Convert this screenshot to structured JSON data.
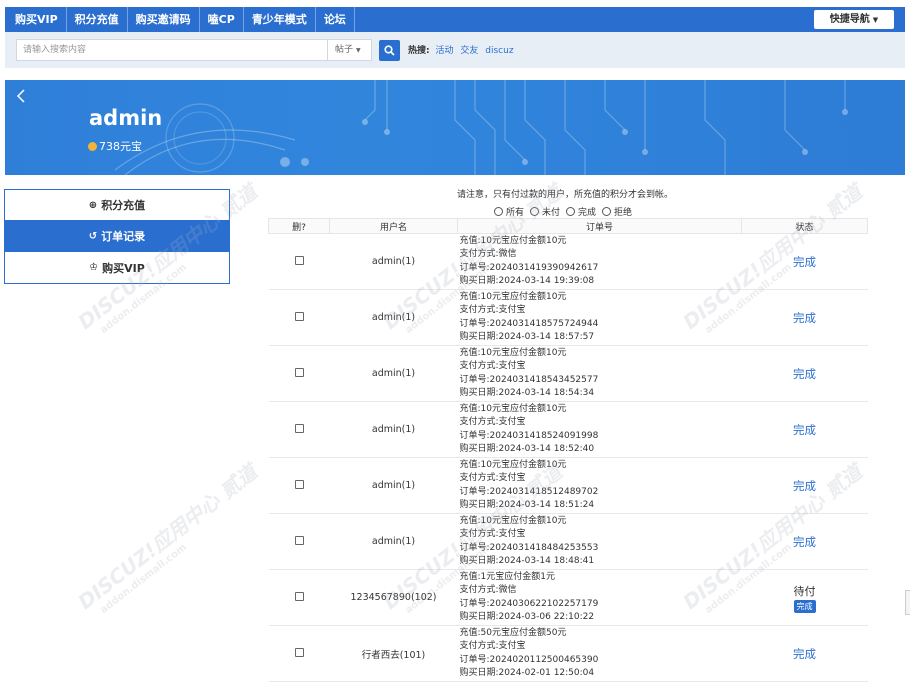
{
  "topnav": {
    "items": [
      "购买VIP",
      "积分充值",
      "购买邀请码",
      "嗑CP",
      "青少年模式",
      "论坛"
    ],
    "quick_nav": "快捷导航"
  },
  "search": {
    "placeholder": "请输入搜索内容",
    "scope": "帖子",
    "hot_label": "热搜:",
    "hot_links": [
      "活动",
      "交友",
      "discuz"
    ]
  },
  "banner": {
    "username": "admin",
    "balance": "738元宝"
  },
  "sidebar": {
    "items": [
      {
        "label": "积分充值",
        "icon": "coin-icon",
        "active": false
      },
      {
        "label": "订单记录",
        "icon": "history-icon",
        "active": true
      },
      {
        "label": "购买VIP",
        "icon": "crown-icon",
        "active": false
      }
    ]
  },
  "notice": "请注意，只有付过款的用户，所充值的积分才会到帐。",
  "filters": [
    "所有",
    "未付",
    "完成",
    "拒绝"
  ],
  "table": {
    "headers": [
      "删?",
      "用户名",
      "订单号",
      "状态"
    ],
    "rows": [
      {
        "user": "admin(1)",
        "line1": "充值:10元宝应付金额10元",
        "line2": "支付方式:微信",
        "line3": "订单号:2024031419390942617",
        "line4": "购买日期:2024-03-14 19:39:08",
        "status": "完成"
      },
      {
        "user": "admin(1)",
        "line1": "充值:10元宝应付金额10元",
        "line2": "支付方式:支付宝",
        "line3": "订单号:2024031418575724944",
        "line4": "购买日期:2024-03-14 18:57:57",
        "status": "完成"
      },
      {
        "user": "admin(1)",
        "line1": "充值:10元宝应付金额10元",
        "line2": "支付方式:支付宝",
        "line3": "订单号:2024031418543452577",
        "line4": "购买日期:2024-03-14 18:54:34",
        "status": "完成"
      },
      {
        "user": "admin(1)",
        "line1": "充值:10元宝应付金额10元",
        "line2": "支付方式:支付宝",
        "line3": "订单号:2024031418524091998",
        "line4": "购买日期:2024-03-14 18:52:40",
        "status": "完成"
      },
      {
        "user": "admin(1)",
        "line1": "充值:10元宝应付金额10元",
        "line2": "支付方式:支付宝",
        "line3": "订单号:2024031418512489702",
        "line4": "购买日期:2024-03-14 18:51:24",
        "status": "完成"
      },
      {
        "user": "admin(1)",
        "line1": "充值:10元宝应付金额10元",
        "line2": "支付方式:支付宝",
        "line3": "订单号:2024031418484253553",
        "line4": "购买日期:2024-03-14 18:48:41",
        "status": "完成"
      },
      {
        "user": "1234567890(102)",
        "line1": "充值:1元宝应付金额1元",
        "line2": "支付方式:微信",
        "line3": "订单号:2024030622102257179",
        "line4": "购买日期:2024-03-06 22:10:22",
        "status": "待付",
        "action": "完成"
      },
      {
        "user": "行者西去(101)",
        "line1": "充值:50元宝应付金额50元",
        "line2": "支付方式:支付宝",
        "line3": "订单号:2024020112500465390",
        "line4": "购买日期:2024-02-01 12:50:04",
        "status": "完成"
      }
    ]
  },
  "watermark": {
    "brand": "DISCUZ!应用中心",
    "site": "addon.dismall.com",
    "mark": "贰道"
  },
  "colors": {
    "primary": "#2a6fd0",
    "search_bg": "#e8eef6",
    "coin": "#f3b23a"
  }
}
